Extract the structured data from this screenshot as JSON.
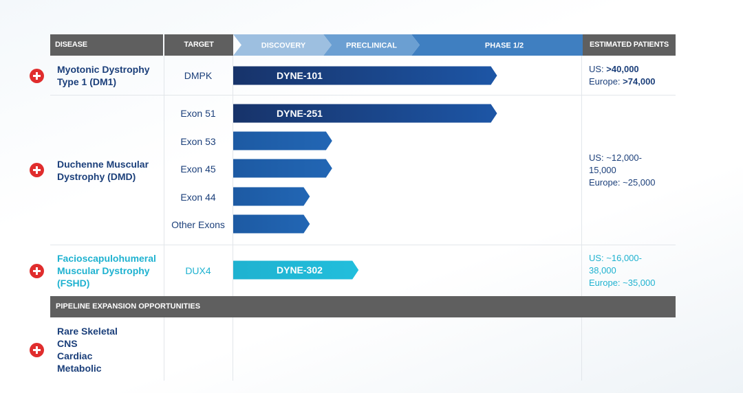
{
  "header": {
    "disease": "DISEASE",
    "target": "TARGET",
    "discovery": "DISCOVERY",
    "preclinical": "PRECLINICAL",
    "phase": "PHASE 1/2",
    "patients": "ESTIMATED PATIENTS"
  },
  "rows": {
    "dm1": {
      "disease": [
        "Myotonic Dystrophy",
        "Type 1 (DM1)"
      ],
      "target": "DMPK",
      "patients": {
        "us_label": "US:",
        "us_value": ">40,000",
        "eu_label": "Europe:",
        "eu_value": ">74,000"
      }
    },
    "dmd": {
      "disease": [
        "Duchenne Muscular",
        "Dystrophy (DMD)"
      ],
      "targets": [
        "Exon 51",
        "Exon 53",
        "Exon 45",
        "Exon 44",
        "Other Exons"
      ],
      "patients": {
        "us_line1": "US: ~12,000-",
        "us_line2": "15,000",
        "eu": "Europe: ~25,000"
      }
    },
    "fshd": {
      "disease": [
        "Facioscapulohumeral",
        "Muscular Dystrophy",
        "(FSHD)"
      ],
      "target": "DUX4",
      "patients": {
        "us_line1": "US: ~16,000-",
        "us_line2": "38,000",
        "eu": "Europe: ~35,000"
      }
    }
  },
  "expansion": {
    "title": "PIPELINE EXPANSION OPPORTUNITIES",
    "items": [
      "Rare Skeletal",
      "CNS",
      "Cardiac",
      "Metabolic"
    ]
  },
  "colors": {
    "header_gray": "#5f5f5f",
    "discovery": "#9dbfe0",
    "preclinical": "#6b9fd2",
    "phase": "#3f7fc1",
    "dark_navy": "#17336a",
    "mid_blue": "#1d5aa3",
    "teal": "#1fb2d0",
    "plus_red": "#e02d2d"
  },
  "chart_data": {
    "type": "bar",
    "orientation": "horizontal",
    "stages": [
      "DISCOVERY",
      "PRECLINICAL",
      "PHASE 1/2"
    ],
    "xlim": [
      0,
      3
    ],
    "bars": [
      {
        "label": "DYNE-101",
        "target": "DMPK",
        "value": 2.5,
        "color": "#17336a"
      },
      {
        "label": "DYNE-251",
        "target": "Exon 51",
        "value": 2.5,
        "color": "#17336a"
      },
      {
        "label": "",
        "target": "Exon 53",
        "value": 1.1,
        "color": "#1d5aa3"
      },
      {
        "label": "",
        "target": "Exon 45",
        "value": 1.1,
        "color": "#1d5aa3"
      },
      {
        "label": "",
        "target": "Exon 44",
        "value": 0.85,
        "color": "#1d5aa3"
      },
      {
        "label": "",
        "target": "Other Exons",
        "value": 0.85,
        "color": "#1d5aa3"
      },
      {
        "label": "DYNE-302",
        "target": "DUX4",
        "value": 1.4,
        "color": "#1fb2d0"
      }
    ]
  }
}
